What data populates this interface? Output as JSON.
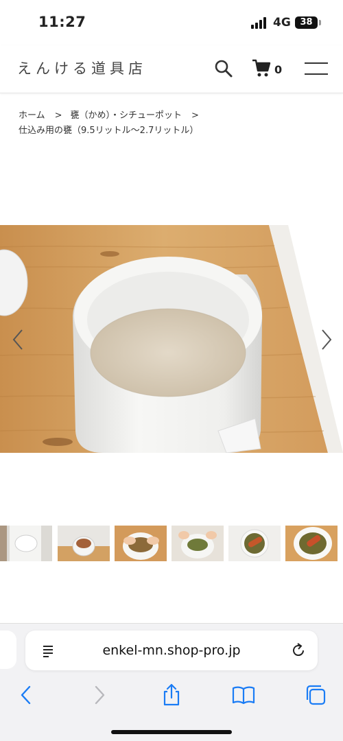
{
  "status_bar": {
    "time": "11:27",
    "network": "4G",
    "battery": "38"
  },
  "header": {
    "shop_name": "えんける道具店",
    "cart_count": "0",
    "icons": [
      "search-icon",
      "cart-icon",
      "hamburger-menu-icon"
    ]
  },
  "breadcrumb": {
    "home": "ホーム",
    "category": "甕（かめ）・シチューポット",
    "current": "仕込み用の甕（9.5リットル〜2.7リットル）"
  },
  "gallery": {
    "main_image_description_icon": "crock-on-table-photo",
    "prev_arrow": "chevron-left-icon",
    "next_arrow": "chevron-right-icon",
    "thumbnail_count": 6
  },
  "browser": {
    "url": "enkel-mn.shop-pro.jp",
    "icons": [
      "reader-icon",
      "reload-icon",
      "back-icon",
      "forward-icon",
      "share-icon",
      "bookmarks-icon",
      "tabs-icon"
    ]
  },
  "colors": {
    "accent_ios_blue": "#1a7cf5",
    "wood": "#d7a463",
    "crock_white": "#f4f3f0"
  }
}
